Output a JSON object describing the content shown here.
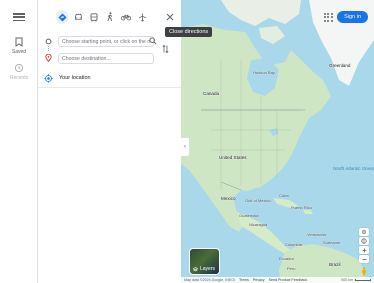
{
  "rail": {
    "saved_label": "Saved",
    "recents_label": "Recents"
  },
  "directions": {
    "modes": [
      {
        "name": "best-travel-mode",
        "icon": "diamond-route-icon"
      },
      {
        "name": "driving",
        "icon": "car-icon"
      },
      {
        "name": "transit",
        "icon": "bus-icon"
      },
      {
        "name": "walking",
        "icon": "walk-icon"
      },
      {
        "name": "cycling",
        "icon": "bicycle-icon"
      },
      {
        "name": "flights",
        "icon": "plane-icon"
      }
    ],
    "close_tooltip": "Close directions",
    "start_placeholder": "Choose starting point, or click on the map...",
    "destination_placeholder": "Choose destination...",
    "your_location_label": "Your location"
  },
  "header": {
    "sign_in_label": "Sign in"
  },
  "map": {
    "layers_label": "Layers",
    "place_labels": [
      "Greenland",
      "Canada",
      "Hudson Bay",
      "United States",
      "Mexico",
      "Gulf of Mexico",
      "Cuba",
      "Guatemala",
      "Nicaragua",
      "Puerto Rico",
      "Colombia",
      "Venezuela",
      "Suriname",
      "Ecuador",
      "Peru",
      "Brazil"
    ],
    "ocean_label": "North Atlantic Ocean",
    "footer_items": [
      "Map data ©2024 Google, INEGI",
      "Terms",
      "Privacy",
      "Send Product Feedback"
    ],
    "scale_label": "500 km",
    "colors": {
      "water": "#a8d8ea",
      "land": "#cfe6c4",
      "ice": "#f4f6f5",
      "accent": "#1a73e8"
    }
  }
}
